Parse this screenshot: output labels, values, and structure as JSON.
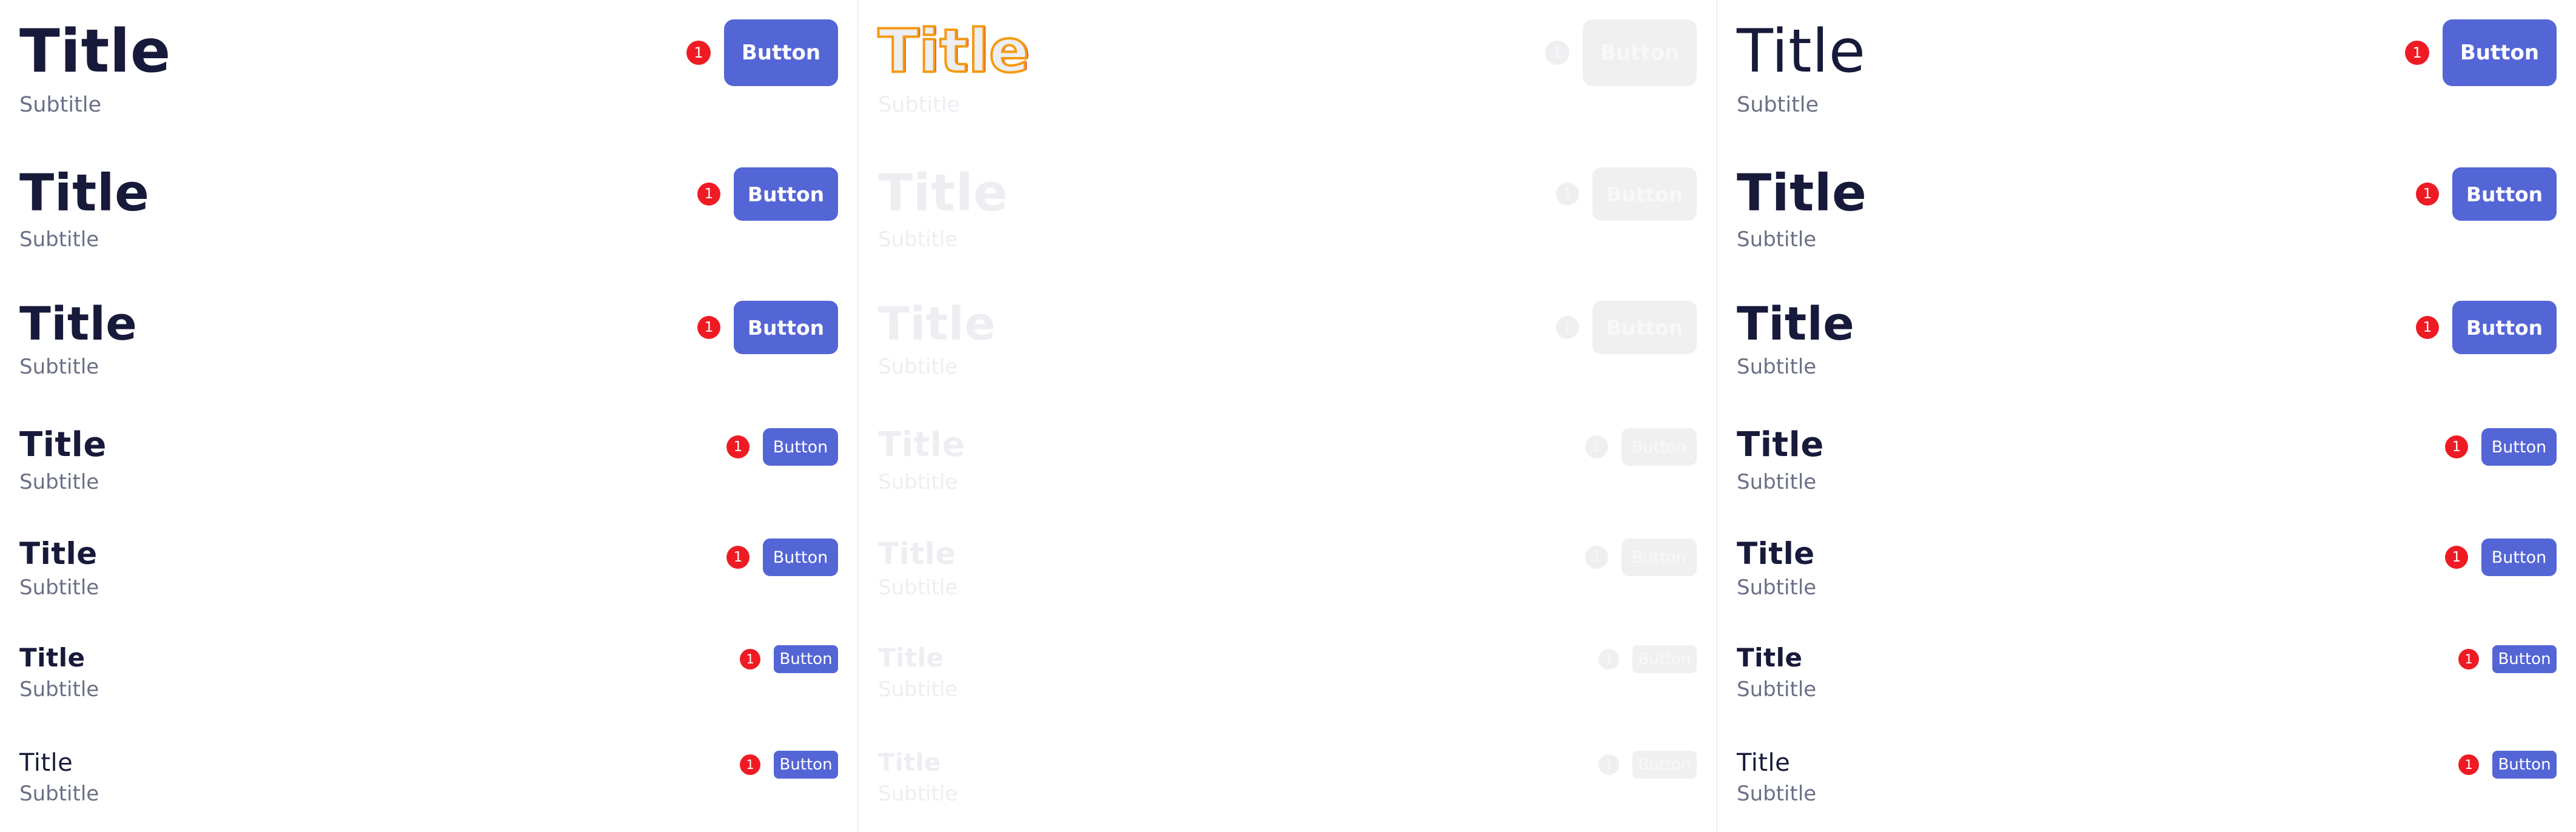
{
  "panels": [
    {
      "rows": [
        {
          "title": "Title",
          "subtitle": "Subtitle",
          "badge": "1",
          "button": "Button"
        },
        {
          "title": "Title",
          "subtitle": "Subtitle",
          "badge": "1",
          "button": "Button"
        },
        {
          "title": "Title",
          "subtitle": "Subtitle",
          "badge": "1",
          "button": "Button"
        },
        {
          "title": "Title",
          "subtitle": "Subtitle",
          "badge": "1",
          "button": "Button"
        },
        {
          "title": "Title",
          "subtitle": "Subtitle",
          "badge": "1",
          "button": "Button"
        },
        {
          "title": "Title",
          "subtitle": "Subtitle",
          "badge": "1",
          "button": "Button"
        },
        {
          "title": "Title",
          "subtitle": "Subtitle",
          "badge": "1",
          "button": "Button"
        }
      ]
    },
    {
      "rows": [
        {
          "title": "Title",
          "subtitle": "Subtitle",
          "badge": "1",
          "button": "Button"
        },
        {
          "title": "Title",
          "subtitle": "Subtitle",
          "badge": "1",
          "button": "Button"
        },
        {
          "title": "Title",
          "subtitle": "Subtitle",
          "badge": "1",
          "button": "Button"
        },
        {
          "title": "Title",
          "subtitle": "Subtitle",
          "badge": "1",
          "button": "Button"
        },
        {
          "title": "Title",
          "subtitle": "Subtitle",
          "badge": "1",
          "button": "Button"
        },
        {
          "title": "Title",
          "subtitle": "Subtitle",
          "badge": "1",
          "button": "Button"
        },
        {
          "title": "Title",
          "subtitle": "Subtitle",
          "badge": "1",
          "button": "Button"
        }
      ]
    },
    {
      "rows": [
        {
          "title": "Title",
          "subtitle": "Subtitle",
          "badge": "1",
          "button": "Button"
        },
        {
          "title": "Title",
          "subtitle": "Subtitle",
          "badge": "1",
          "button": "Button"
        },
        {
          "title": "Title",
          "subtitle": "Subtitle",
          "badge": "1",
          "button": "Button"
        },
        {
          "title": "Title",
          "subtitle": "Subtitle",
          "badge": "1",
          "button": "Button"
        },
        {
          "title": "Title",
          "subtitle": "Subtitle",
          "badge": "1",
          "button": "Button"
        },
        {
          "title": "Title",
          "subtitle": "Subtitle",
          "badge": "1",
          "button": "Button"
        },
        {
          "title": "Title",
          "subtitle": "Subtitle",
          "badge": "1",
          "button": "Button"
        }
      ]
    }
  ],
  "colors": {
    "accent": "#5465d6",
    "badge": "#ef1b24",
    "title": "#171a3a",
    "subtitle": "#6b6f86",
    "disabled": "#f0f0f1"
  }
}
